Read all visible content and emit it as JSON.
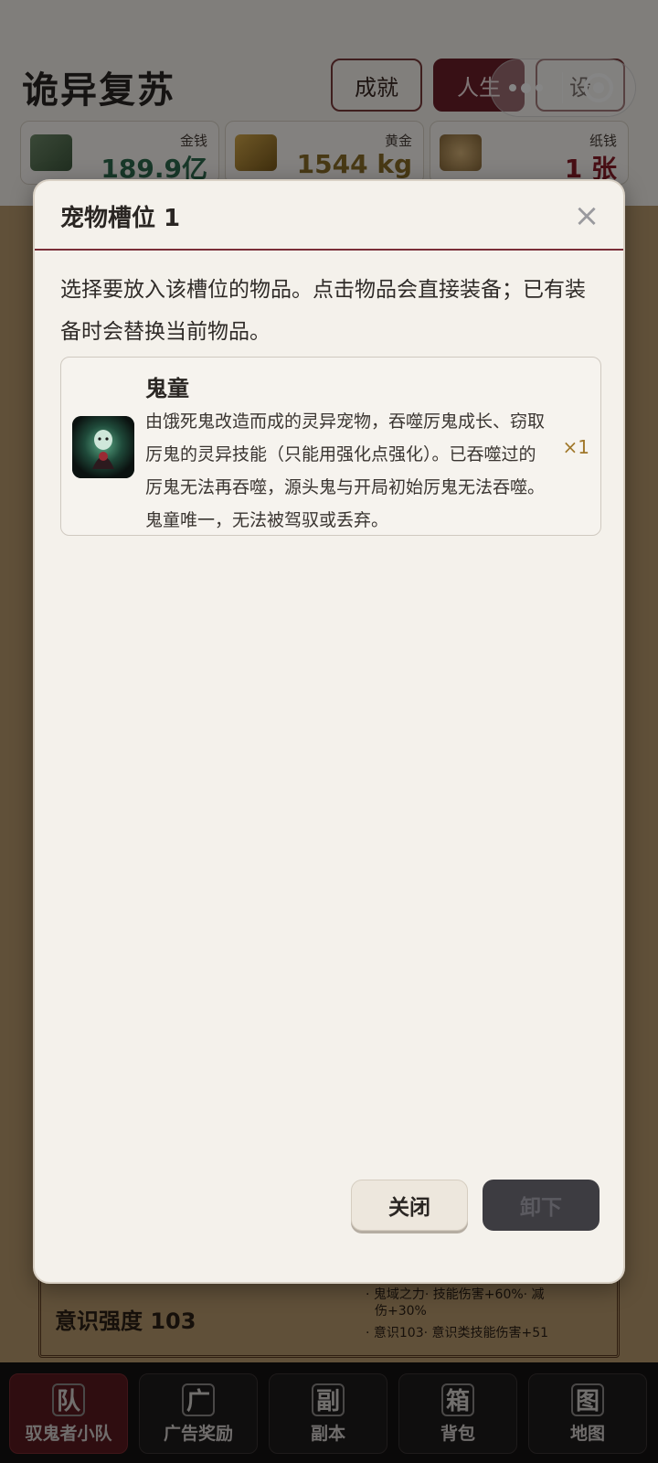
{
  "app": {
    "title": "诡异复苏",
    "header_buttons": [
      "成就",
      "人生",
      "设"
    ]
  },
  "resources": [
    {
      "label": "金钱",
      "value": "189.9亿",
      "color": "#2f6b4f",
      "icon": "banknote-icon"
    },
    {
      "label": "黄金",
      "value": "1544 kg",
      "color": "#8a6d2a",
      "icon": "gold-bar-icon"
    },
    {
      "label": "纸钱",
      "value": "1 张",
      "color": "#8b1d2a",
      "icon": "paper-money-icon"
    }
  ],
  "background": {
    "consciousness_label": "意识强度 103",
    "side_text": [
      "· 鬼域之力· 技能伤害+60%· 减",
      "伤+30%",
      "· 意识103· 意识类技能伤害+51"
    ]
  },
  "modal": {
    "title": "宠物槽位 1",
    "close_symbol": "×",
    "description": "选择要放入该槽位的物品。点击物品会直接装备；已有装备时会替换当前物品。",
    "items": [
      {
        "name": "鬼童",
        "description": "由饿死鬼改造而成的灵异宠物，吞噬厉鬼成长、窃取厉鬼的灵异技能（只能用强化点强化）。已吞噬过的厉鬼无法再吞噬，源头鬼与开局初始厉鬼无法吞噬。鬼童唯一，无法被驾驭或丢弃。",
        "quantity": "×1",
        "icon": "ghost-child-portrait"
      }
    ],
    "buttons": {
      "close": "关闭",
      "unequip": "卸下"
    }
  },
  "tabbar": [
    {
      "glyph": "队",
      "label": "驭鬼者小队",
      "active": true
    },
    {
      "glyph": "广",
      "label": "广告奖励",
      "active": false
    },
    {
      "glyph": "副",
      "label": "副本",
      "active": false
    },
    {
      "glyph": "箱",
      "label": "背包",
      "active": false
    },
    {
      "glyph": "图",
      "label": "地图",
      "active": false
    }
  ],
  "colors": {
    "accent": "#7a2e38",
    "modal_bg": "#f4f1eb",
    "tabbar_bg": "#141212"
  }
}
